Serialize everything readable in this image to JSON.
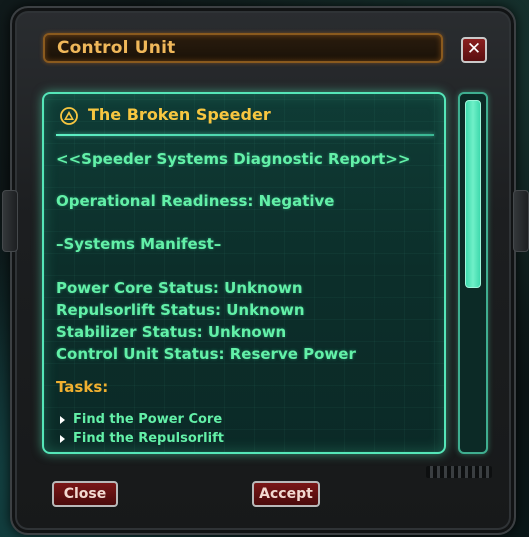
{
  "window": {
    "title": "Control Unit",
    "close_icon": "close-icon"
  },
  "mission": {
    "icon": "triangle-mission-icon",
    "title": "The Broken Speeder",
    "lines": [
      "<<Speeder Systems Diagnostic Report>>",
      "Operational Readiness: Negative",
      "–Systems Manifest–",
      "Power Core Status: Unknown",
      "Repulsorlift Status: Unknown",
      "Stabilizer Status: Unknown",
      "Control Unit Status: Reserve Power"
    ],
    "tasks_label": "Tasks:",
    "tasks": [
      "Find the Power Core",
      "Find the Repulsorlift"
    ]
  },
  "buttons": {
    "close": "Close",
    "accept": "Accept"
  },
  "colors": {
    "accent_orange": "#f0b85a",
    "panel_border": "#55e6b8",
    "text_green": "#63f0a8",
    "button_red": "#7a1717"
  }
}
